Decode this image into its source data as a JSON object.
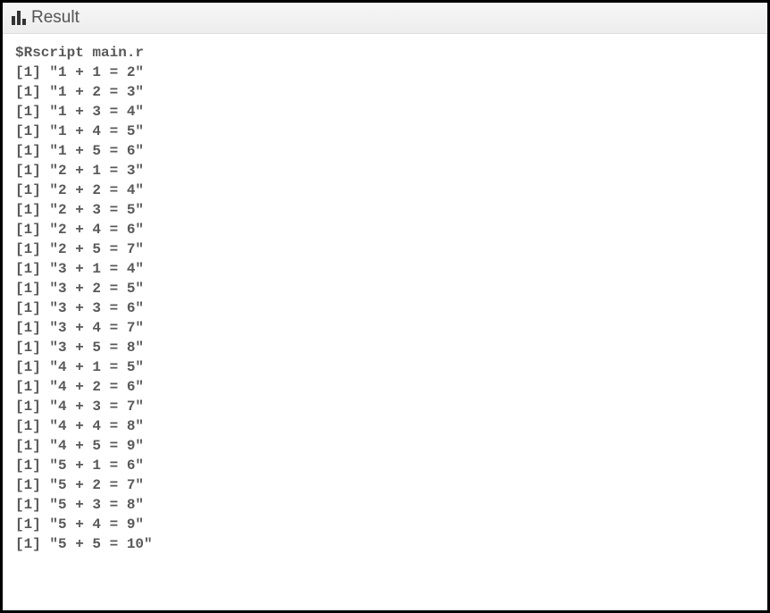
{
  "header": {
    "title": "Result"
  },
  "console": {
    "command": "$Rscript main.r",
    "lines": [
      "[1] \"1 + 1 = 2\"",
      "[1] \"1 + 2 = 3\"",
      "[1] \"1 + 3 = 4\"",
      "[1] \"1 + 4 = 5\"",
      "[1] \"1 + 5 = 6\"",
      "[1] \"2 + 1 = 3\"",
      "[1] \"2 + 2 = 4\"",
      "[1] \"2 + 3 = 5\"",
      "[1] \"2 + 4 = 6\"",
      "[1] \"2 + 5 = 7\"",
      "[1] \"3 + 1 = 4\"",
      "[1] \"3 + 2 = 5\"",
      "[1] \"3 + 3 = 6\"",
      "[1] \"3 + 4 = 7\"",
      "[1] \"3 + 5 = 8\"",
      "[1] \"4 + 1 = 5\"",
      "[1] \"4 + 2 = 6\"",
      "[1] \"4 + 3 = 7\"",
      "[1] \"4 + 4 = 8\"",
      "[1] \"4 + 5 = 9\"",
      "[1] \"5 + 1 = 6\"",
      "[1] \"5 + 2 = 7\"",
      "[1] \"5 + 3 = 8\"",
      "[1] \"5 + 4 = 9\"",
      "[1] \"5 + 5 = 10\""
    ]
  }
}
